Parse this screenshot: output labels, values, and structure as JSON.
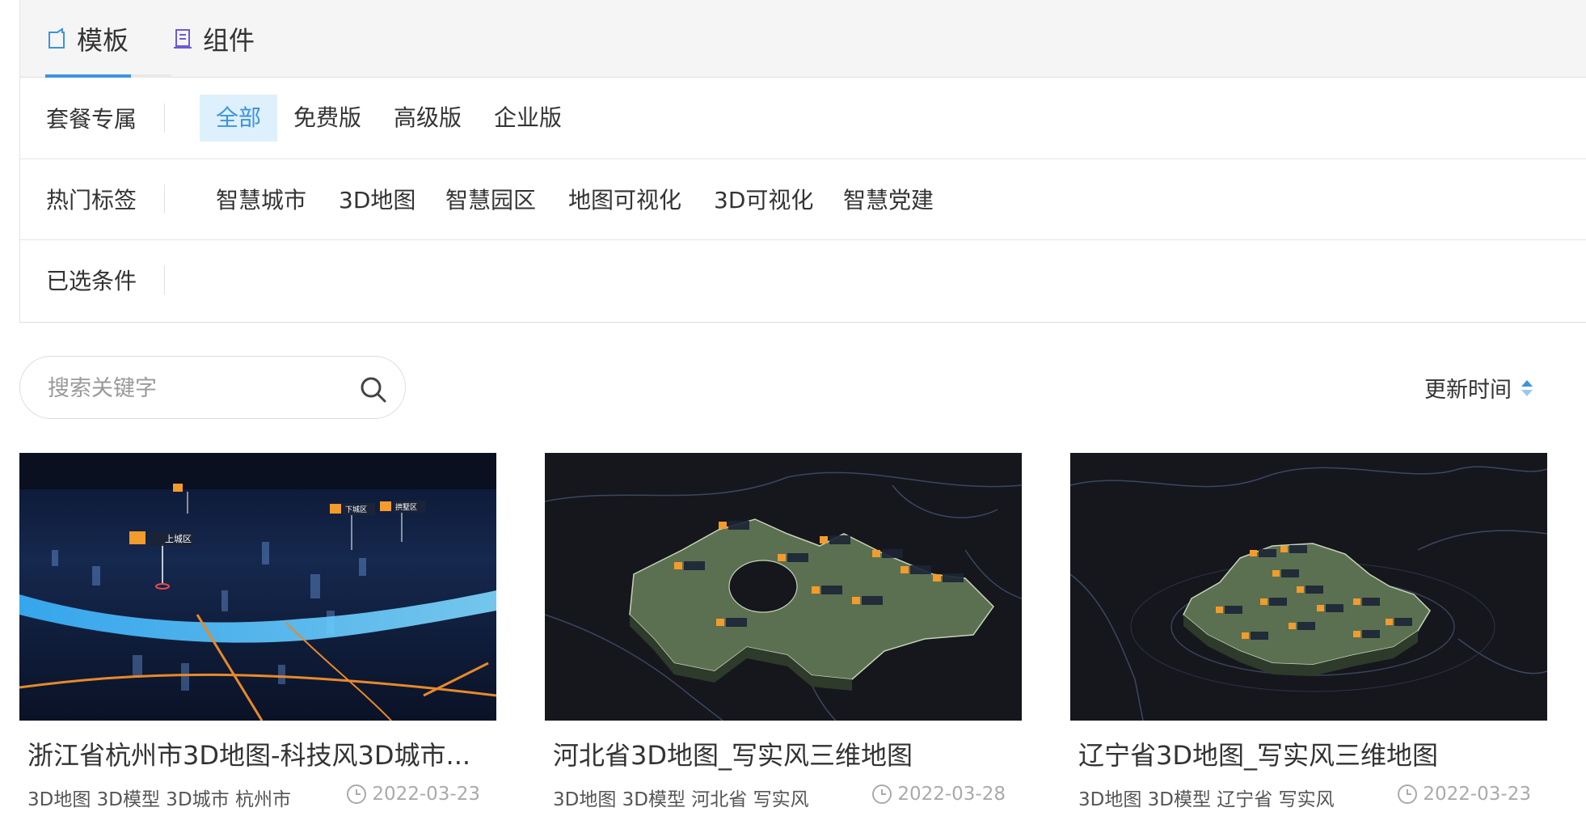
{
  "tabs": [
    {
      "label": "模板",
      "icon": "template-icon",
      "active": true
    },
    {
      "label": "组件",
      "icon": "component-icon",
      "active": false
    }
  ],
  "filters": {
    "package": {
      "title": "套餐专属",
      "options": [
        "全部",
        "免费版",
        "高级版",
        "企业版"
      ],
      "selected": "全部"
    },
    "hot_tags": {
      "title": "热门标签",
      "options": [
        "智慧城市",
        "3D地图",
        "智慧园区",
        "地图可视化",
        "3D可视化",
        "智慧党建"
      ]
    },
    "selected_conditions": {
      "title": "已选条件"
    }
  },
  "search": {
    "placeholder": "搜索关键字",
    "value": ""
  },
  "sort": {
    "label": "更新时间"
  },
  "colors": {
    "accent": "#3b93e0",
    "selected_bg": "#def0fc"
  },
  "cards": [
    {
      "title": "浙江省杭州市3D地图-科技风3D城市...",
      "tags": "3D地图 3D模型 3D城市 杭州市",
      "date": "2022-03-23",
      "thumb_labels": [
        "上城区",
        "下城区",
        "拱墅区"
      ]
    },
    {
      "title": "河北省3D地图_写实风三维地图",
      "tags": "3D地图 3D模型 河北省 写实风",
      "date": "2022-03-28"
    },
    {
      "title": "辽宁省3D地图_写实风三维地图",
      "tags": "3D地图 3D模型 辽宁省 写实风",
      "date": "2022-03-23"
    }
  ]
}
